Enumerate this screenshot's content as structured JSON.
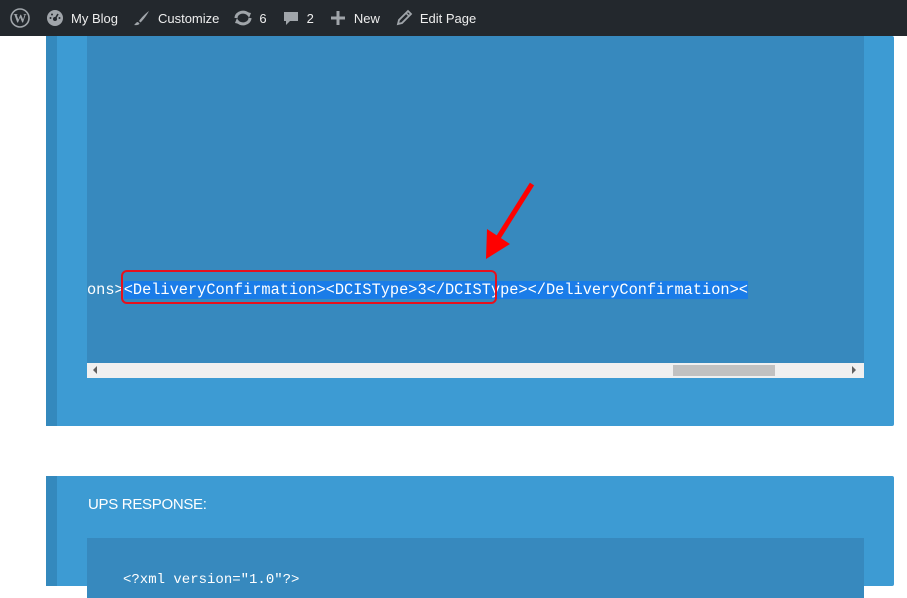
{
  "adminbar": {
    "items": [
      {
        "icon": "wordpress-logo-icon",
        "label": ""
      },
      {
        "icon": "dashboard-icon",
        "label": "My Blog"
      },
      {
        "icon": "paintbrush-icon",
        "label": "Customize"
      },
      {
        "icon": "updates-icon",
        "label": "6"
      },
      {
        "icon": "comment-icon",
        "label": "2"
      },
      {
        "icon": "plus-icon",
        "label": "New"
      },
      {
        "icon": "pencil-icon",
        "label": "Edit Page"
      }
    ]
  },
  "request_block": {
    "code_prefix": "ons>",
    "code_selected": "<DeliveryConfirmation><DCISType>3</DCISType></DeliveryConfirmation><",
    "annotation": {
      "type": "red-arrow-and-box",
      "color": "#e8101c"
    }
  },
  "response_block": {
    "label": "UPS RESPONSE:",
    "code_first_line": "<?xml version=\"1.0\"?>"
  },
  "colors": {
    "adminbar_bg": "#23282d",
    "card_bg": "#3d9bd3",
    "code_bg": "#3789be",
    "selection": "#1a7ce8",
    "annotation": "#e8101c"
  }
}
